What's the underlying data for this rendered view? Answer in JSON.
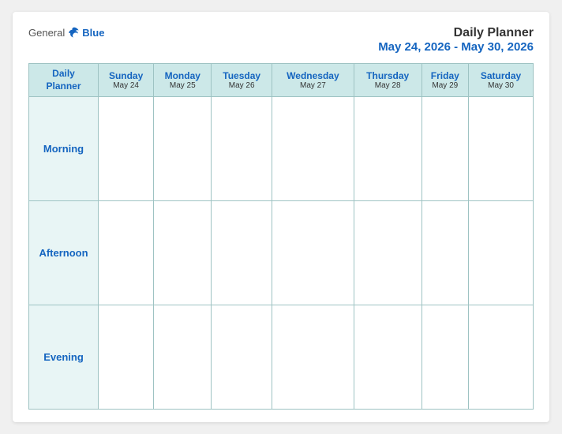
{
  "logo": {
    "general": "General",
    "blue": "Blue"
  },
  "title": {
    "main": "Daily Planner",
    "date_range": "May 24, 2026 - May 30, 2026"
  },
  "header": {
    "label": "Daily\nPlanner",
    "days": [
      {
        "name": "Sunday",
        "date": "May 24"
      },
      {
        "name": "Monday",
        "date": "May 25"
      },
      {
        "name": "Tuesday",
        "date": "May 26"
      },
      {
        "name": "Wednesday",
        "date": "May 27"
      },
      {
        "name": "Thursday",
        "date": "May 28"
      },
      {
        "name": "Friday",
        "date": "May 29"
      },
      {
        "name": "Saturday",
        "date": "May 30"
      }
    ]
  },
  "rows": [
    {
      "label": "Morning"
    },
    {
      "label": "Afternoon"
    },
    {
      "label": "Evening"
    }
  ]
}
